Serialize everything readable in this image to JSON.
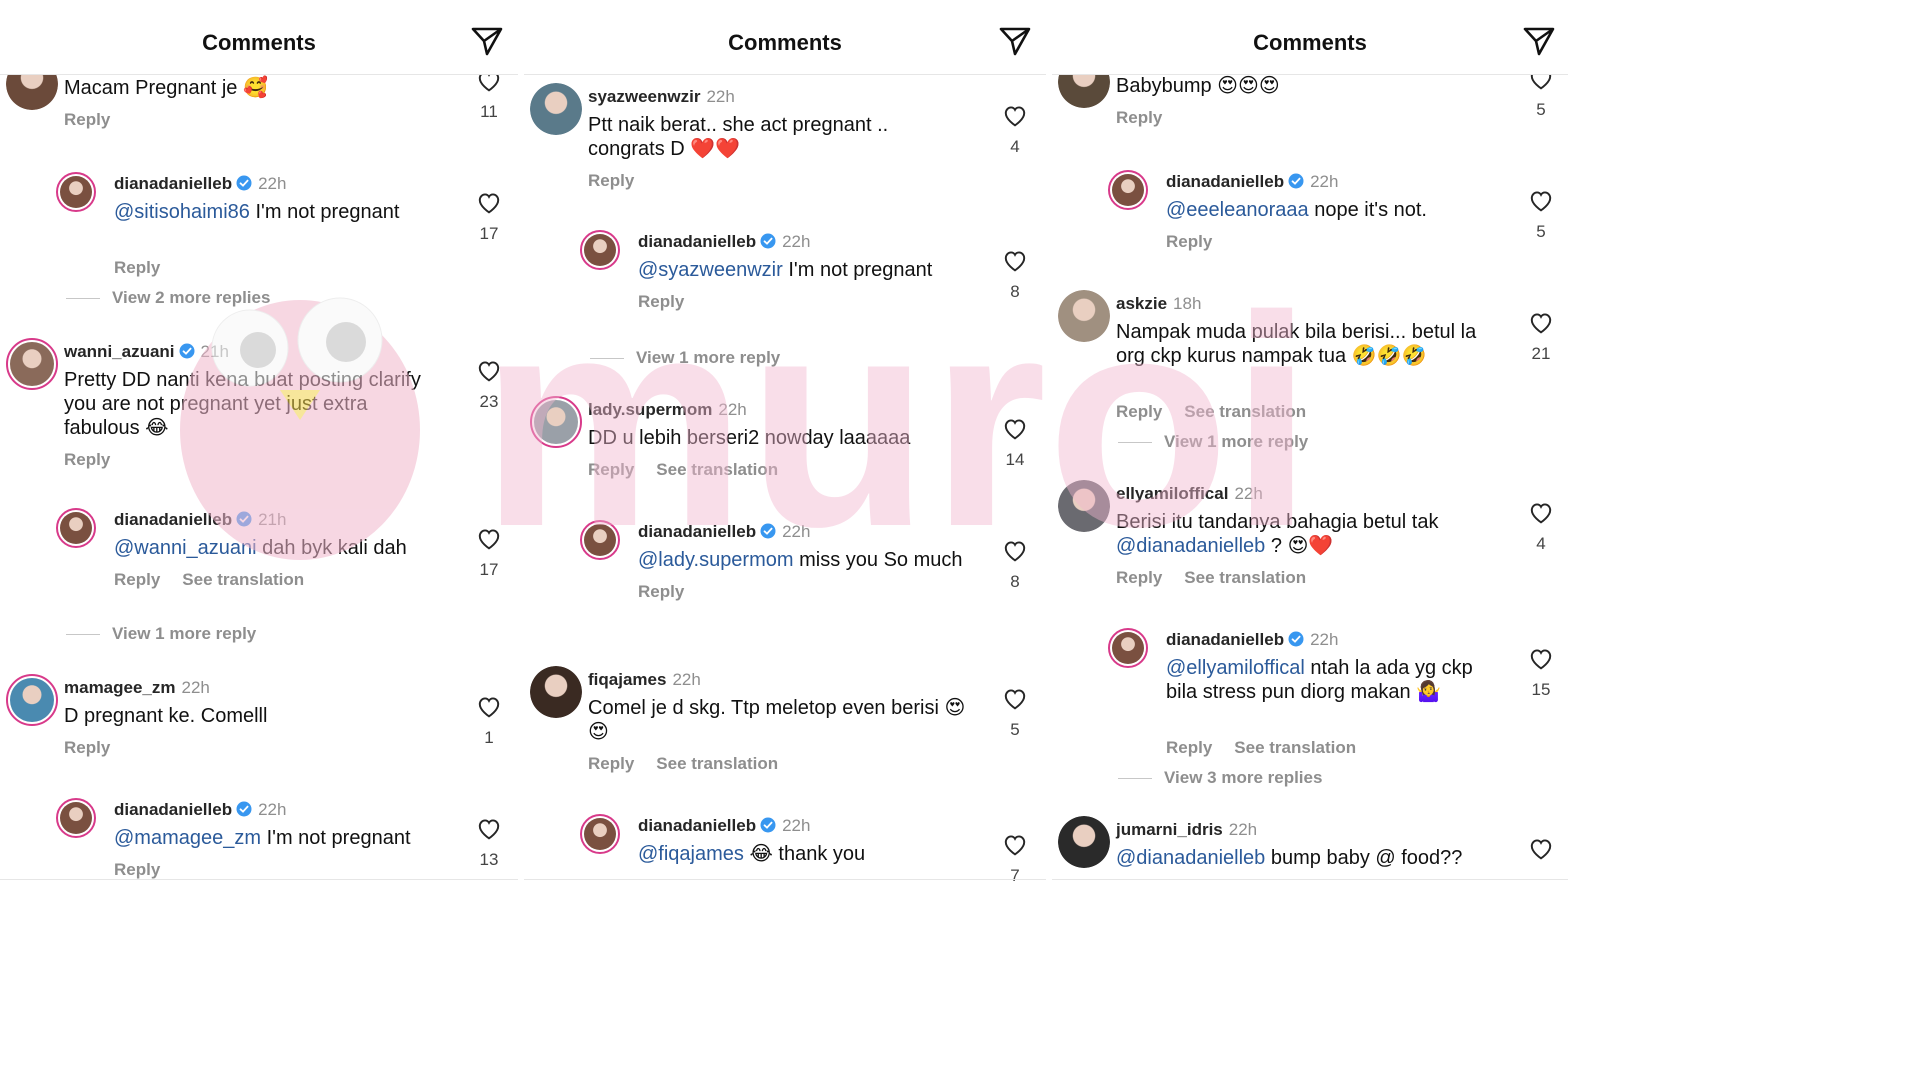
{
  "panels": [
    {
      "title": "Comments",
      "items": [
        {
          "type": "comment",
          "avatar_color": "#6b4a3a",
          "ring": false,
          "username": "",
          "verified": false,
          "time": "",
          "text_parts": [
            {
              "t": "Macam Pregnant je "
            },
            {
              "t": "🥰",
              "e": 1
            }
          ],
          "actions": [
            "Reply"
          ],
          "likes": "11"
        },
        {
          "type": "reply",
          "avatar_color": "#7a5040",
          "ring": true,
          "username": "dianadanielleb",
          "verified": true,
          "time": "22h",
          "text_parts": [
            {
              "t": "@sitisohaimi86",
              "m": 1
            },
            {
              "t": " I'm not pregnant"
            }
          ],
          "actions": [
            "Reply"
          ],
          "likes": "17"
        },
        {
          "type": "more",
          "text": "View 2 more replies"
        },
        {
          "type": "comment",
          "avatar_color": "#8a6a5a",
          "ring": true,
          "username": "wanni_azuani",
          "verified": true,
          "time": "21h",
          "text_parts": [
            {
              "t": "Pretty DD nanti kena buat posting clarify you are not pregnant yet just extra fabulous "
            },
            {
              "t": "😂",
              "e": 1
            }
          ],
          "actions": [
            "Reply"
          ],
          "likes": "23"
        },
        {
          "type": "reply",
          "avatar_color": "#7a5040",
          "ring": true,
          "username": "dianadanielleb",
          "verified": true,
          "time": "21h",
          "text_parts": [
            {
              "t": "@wanni_azuani",
              "m": 1
            },
            {
              "t": " dah byk kali dah"
            }
          ],
          "actions": [
            "Reply",
            "See translation"
          ],
          "likes": "17"
        },
        {
          "type": "more",
          "text": "View 1 more reply"
        },
        {
          "type": "comment",
          "avatar_color": "#4a8ab0",
          "ring": true,
          "username": "mamagee_zm",
          "verified": false,
          "time": "22h",
          "text_parts": [
            {
              "t": "D pregnant ke.  Comelll"
            }
          ],
          "actions": [
            "Reply"
          ],
          "likes": "1"
        },
        {
          "type": "reply",
          "avatar_color": "#7a5040",
          "ring": true,
          "username": "dianadanielleb",
          "verified": true,
          "time": "22h",
          "text_parts": [
            {
              "t": "@mamagee_zm",
              "m": 1
            },
            {
              "t": " I'm not pregnant"
            }
          ],
          "actions": [
            "Reply"
          ],
          "likes": "13"
        }
      ]
    },
    {
      "title": "Comments",
      "items": [
        {
          "type": "comment",
          "avatar_color": "#5a7a8a",
          "ring": false,
          "username": "syazweenwzir",
          "verified": false,
          "time": "22h",
          "text_parts": [
            {
              "t": "Ptt naik berat.. she act pregnant .. congrats D "
            },
            {
              "t": "❤️❤️",
              "e": 1
            }
          ],
          "actions": [
            "Reply"
          ],
          "likes": "4"
        },
        {
          "type": "reply",
          "avatar_color": "#7a5040",
          "ring": true,
          "username": "dianadanielleb",
          "verified": true,
          "time": "22h",
          "text_parts": [
            {
              "t": "@syazweenwzir",
              "m": 1
            },
            {
              "t": " I'm not pregnant"
            }
          ],
          "actions": [
            "Reply"
          ],
          "likes": "8"
        },
        {
          "type": "more",
          "text": "View 1 more reply"
        },
        {
          "type": "comment",
          "avatar_color": "#9aa0a8",
          "ring": true,
          "username": "lady.supermom",
          "verified": false,
          "time": "22h",
          "text_parts": [
            {
              "t": "DD u lebih berseri2 nowday laaaaaa"
            }
          ],
          "actions": [
            "Reply",
            "See translation"
          ],
          "likes": "14"
        },
        {
          "type": "reply",
          "avatar_color": "#7a5040",
          "ring": true,
          "username": "dianadanielleb",
          "verified": true,
          "time": "22h",
          "text_parts": [
            {
              "t": "@lady.supermom",
              "m": 1
            },
            {
              "t": " miss you So much"
            }
          ],
          "actions": [
            "Reply"
          ],
          "likes": "8"
        },
        {
          "type": "comment",
          "avatar_color": "#3a2a22",
          "ring": false,
          "username": "fiqajames",
          "verified": false,
          "time": "22h",
          "text_parts": [
            {
              "t": "Comel je d skg. Ttp meletop even berisi "
            },
            {
              "t": "😍😍",
              "e": 1
            }
          ],
          "actions": [
            "Reply",
            "See translation"
          ],
          "likes": "5"
        },
        {
          "type": "reply",
          "avatar_color": "#7a5040",
          "ring": true,
          "username": "dianadanielleb",
          "verified": true,
          "time": "22h",
          "text_parts": [
            {
              "t": "@fiqajames",
              "m": 1
            },
            {
              "t": " "
            },
            {
              "t": "😂",
              "e": 1
            },
            {
              "t": " thank you"
            }
          ],
          "actions": [],
          "likes": "7"
        }
      ]
    },
    {
      "title": "Comments",
      "items": [
        {
          "type": "comment",
          "avatar_color": "#5a4a3a",
          "ring": false,
          "username": "",
          "verified": false,
          "time": "",
          "text_parts": [
            {
              "t": "Babybump "
            },
            {
              "t": "😍😍😍",
              "e": 1
            }
          ],
          "actions": [
            "Reply"
          ],
          "likes": "5"
        },
        {
          "type": "reply",
          "avatar_color": "#7a5040",
          "ring": true,
          "username": "dianadanielleb",
          "verified": true,
          "time": "22h",
          "text_parts": [
            {
              "t": "@eeeleanoraaa",
              "m": 1
            },
            {
              "t": " nope it's not."
            }
          ],
          "actions": [
            "Reply"
          ],
          "likes": "5"
        },
        {
          "type": "comment",
          "avatar_color": "#a09080",
          "ring": false,
          "username": "askzie",
          "verified": false,
          "time": "18h",
          "text_parts": [
            {
              "t": "Nampak muda pulak bila berisi... betul la org ckp kurus nampak tua "
            },
            {
              "t": "🤣🤣🤣",
              "e": 1
            }
          ],
          "actions": [
            "Reply",
            "See translation"
          ],
          "likes": "21"
        },
        {
          "type": "more",
          "text": "View 1 more reply"
        },
        {
          "type": "comment",
          "avatar_color": "#6a6a70",
          "ring": false,
          "username": "ellyamiloffical",
          "verified": false,
          "time": "22h",
          "text_parts": [
            {
              "t": "Berisi itu tandanya bahagia betul tak "
            },
            {
              "t": "@dianadanielleb",
              "m": 1
            },
            {
              "t": " ? "
            },
            {
              "t": "😍❤️",
              "e": 1
            }
          ],
          "actions": [
            "Reply",
            "See translation"
          ],
          "likes": "4"
        },
        {
          "type": "reply",
          "avatar_color": "#7a5040",
          "ring": true,
          "username": "dianadanielleb",
          "verified": true,
          "time": "22h",
          "text_parts": [
            {
              "t": "@ellyamiloffical",
              "m": 1
            },
            {
              "t": " ntah la ada yg ckp bila stress pun diorg makan "
            },
            {
              "t": "🤷‍♀️",
              "e": 1
            }
          ],
          "actions": [
            "Reply",
            "See translation"
          ],
          "likes": "15"
        },
        {
          "type": "more",
          "text": "View 3 more replies"
        },
        {
          "type": "comment",
          "avatar_color": "#2a2a2a",
          "ring": false,
          "username": "jumarni_idris",
          "verified": false,
          "time": "22h",
          "text_parts": [
            {
              "t": "@dianadanielleb",
              "m": 1
            },
            {
              "t": " bump baby @ food??"
            }
          ],
          "actions": [],
          "likes": ""
        }
      ]
    }
  ],
  "watermark": {
    "text": "muroi",
    "color": "#f2b7cf"
  }
}
